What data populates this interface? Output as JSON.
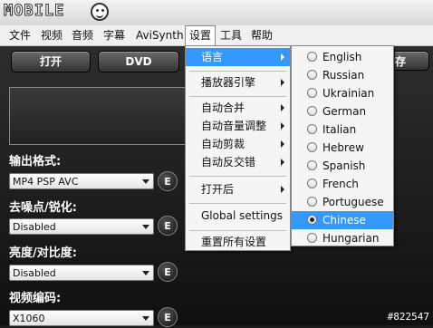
{
  "app": {
    "logo_text": "MOBILE"
  },
  "menubar": {
    "items": [
      "文件",
      "视频",
      "音频",
      "字幕",
      "AviSynth",
      "设置",
      "工具",
      "帮助"
    ]
  },
  "toolbar": {
    "open_label": "打开",
    "dvd_label": "DVD",
    "save_label": "存"
  },
  "settings_menu": {
    "items": [
      {
        "label": "语言",
        "has_submenu": true
      },
      {
        "label": "播放器引擎",
        "has_submenu": true
      },
      {
        "label": "自动合并",
        "has_submenu": true
      },
      {
        "label": "自动音量调整",
        "has_submenu": true
      },
      {
        "label": "自动剪裁",
        "has_submenu": true
      },
      {
        "label": "自动反交错",
        "has_submenu": true
      },
      {
        "label": "打开后",
        "has_submenu": true
      },
      {
        "label": "Global settings",
        "has_submenu": false
      },
      {
        "label": "重置所有设置",
        "has_submenu": false
      }
    ]
  },
  "language_menu": {
    "items": [
      "English",
      "Russian",
      "Ukrainian",
      "German",
      "Italian",
      "Hebrew",
      "Spanish",
      "French",
      "Portuguese",
      "Chinese",
      "Hungarian"
    ],
    "selected": "Chinese"
  },
  "panel": {
    "output_format_label": "输出格式:",
    "output_format_value": "MP4 PSP AVC",
    "denoise_label": "去噪点/锐化:",
    "denoise_value": "Disabled",
    "brightness_label": "亮度/对比度:",
    "brightness_value": "Disabled",
    "video_codec_label": "视频编码:",
    "video_codec_value": "X1060",
    "edit_button_label": "E"
  },
  "watermark": "#822547",
  "colors": {
    "highlight": "#3399ff",
    "background": "#1a1a1a"
  }
}
